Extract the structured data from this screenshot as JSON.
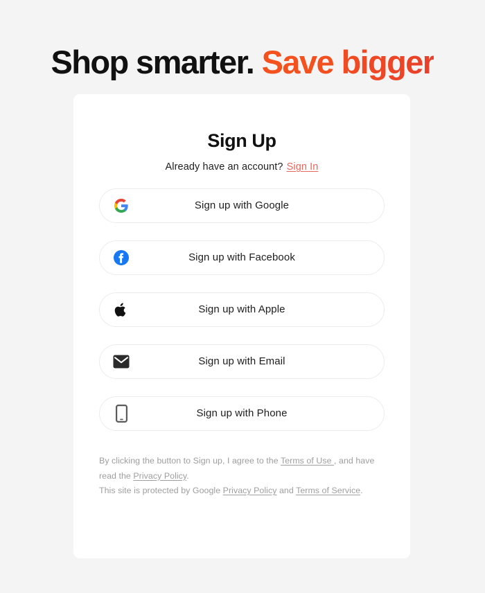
{
  "headline": {
    "dark_text": "Shop smarter.",
    "accent_text": "Save bigger",
    "accent_color_start": "#f4511e",
    "accent_color_end": "#e8402a"
  },
  "card": {
    "title": "Sign Up",
    "subtitle_prompt": "Already have an account?",
    "signin_link": "Sign In",
    "signin_link_color": "#e8665a",
    "providers": [
      {
        "label": "Sign up with Google",
        "icon": "google-icon"
      },
      {
        "label": "Sign up with Facebook",
        "icon": "facebook-icon"
      },
      {
        "label": "Sign up with Apple",
        "icon": "apple-icon"
      },
      {
        "label": "Sign up with Email",
        "icon": "envelope-icon"
      },
      {
        "label": "Sign up with Phone",
        "icon": "smartphone-icon"
      }
    ],
    "legal": {
      "line1_part1": "By clicking the button to Sign up, I agree to the ",
      "line1_link1": "Terms of Use ",
      "line1_part2": ", and have read the ",
      "line1_link2": "Privacy Policy",
      "line1_part3": ".",
      "line2_part1": "This site is protected by Google ",
      "line2_link1": "Privacy Policy",
      "line2_part2": " and ",
      "line2_link2": "Terms of Service",
      "line2_part3": "."
    }
  }
}
